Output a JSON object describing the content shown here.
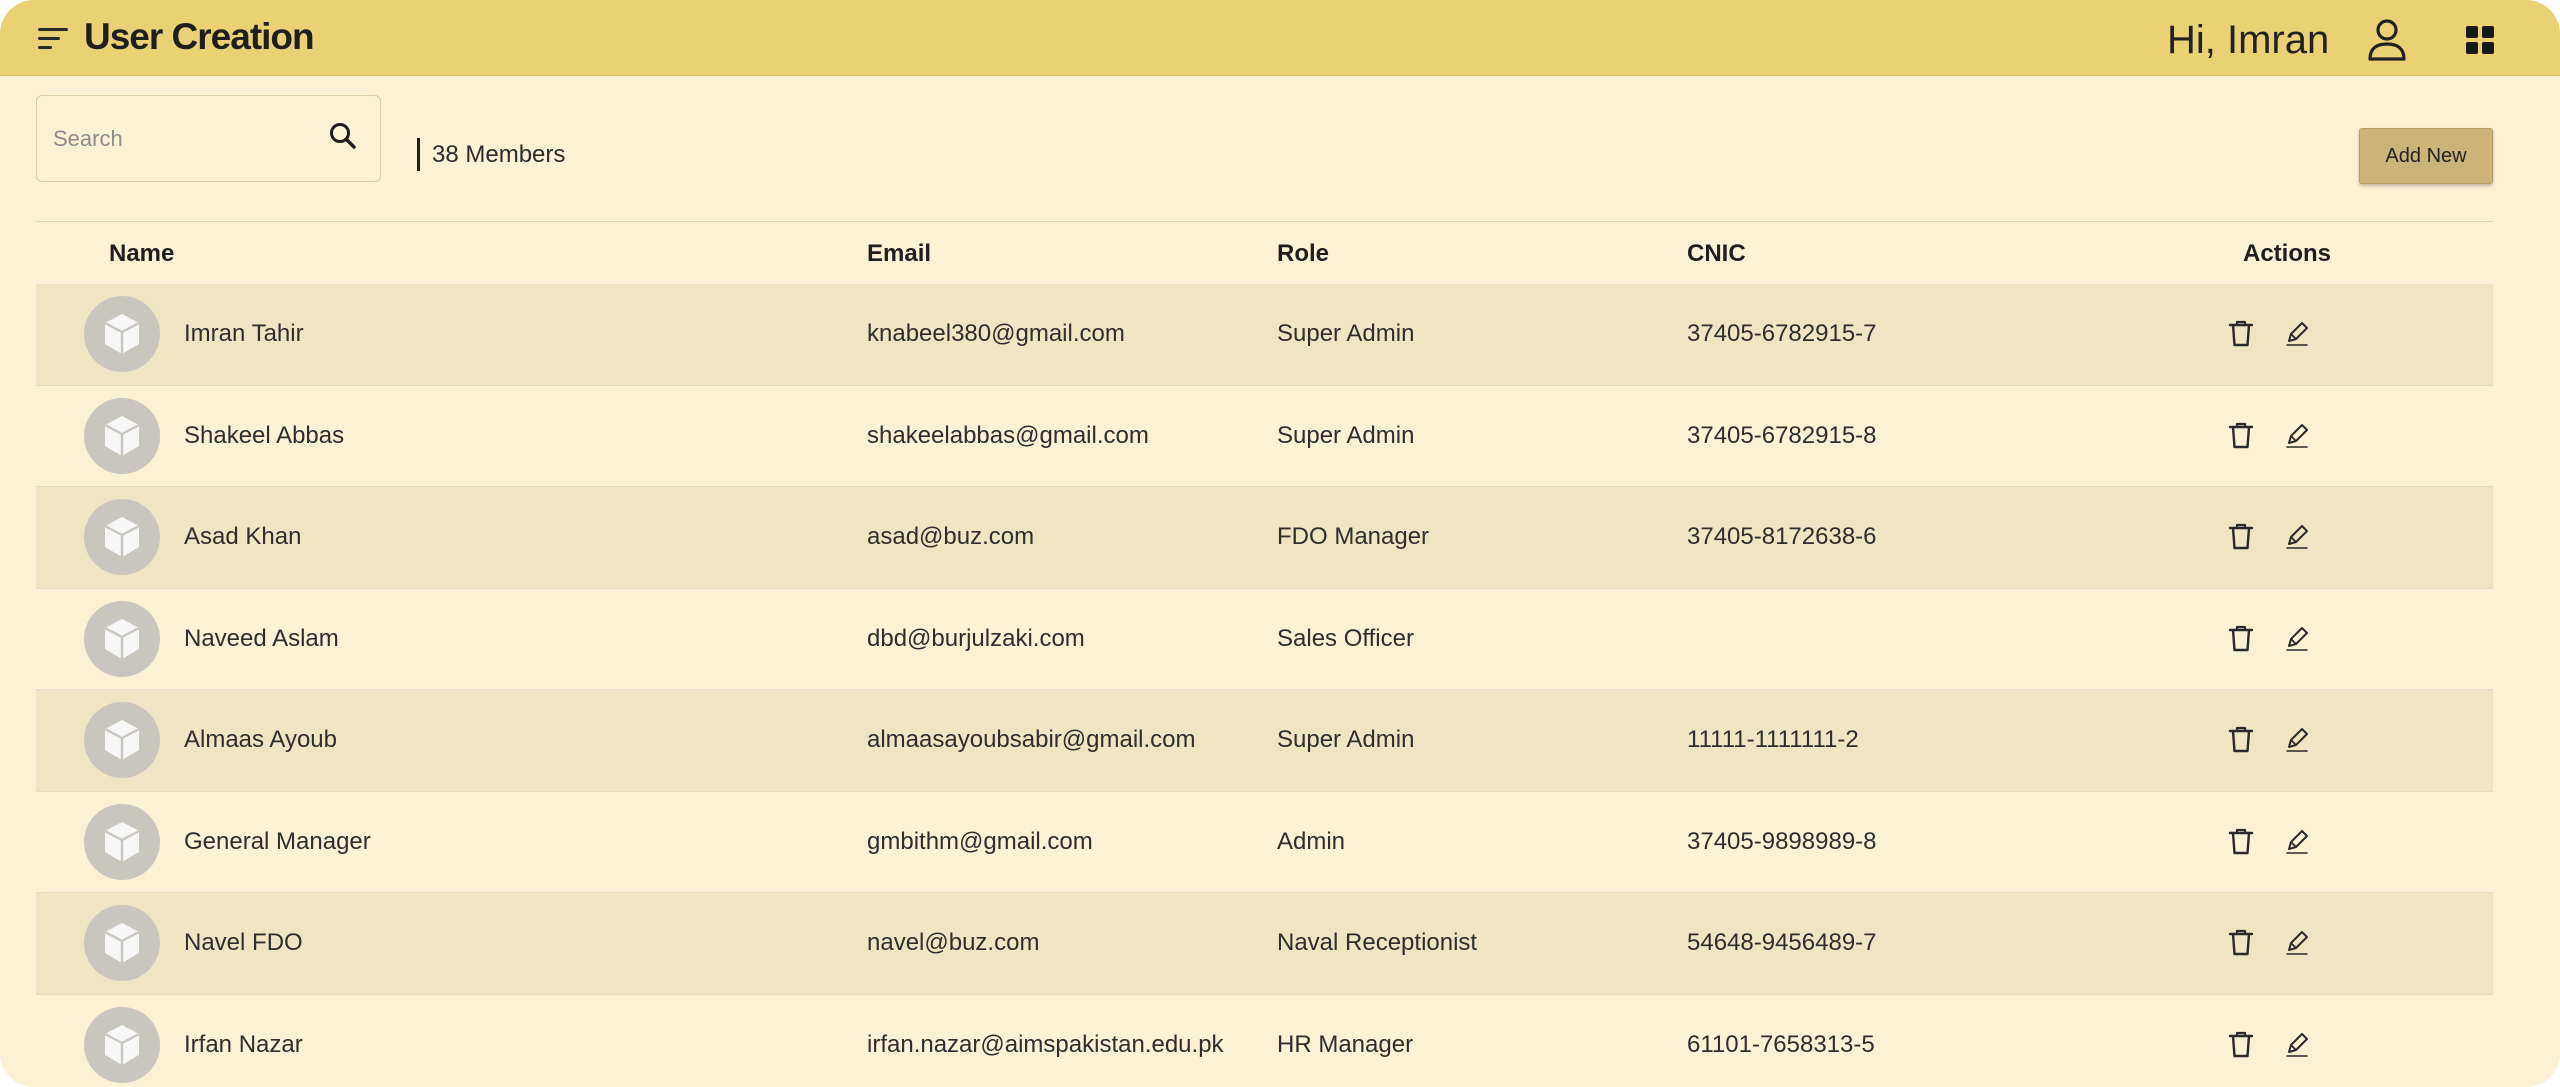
{
  "header": {
    "title": "User Creation",
    "greeting": "Hi, Imran",
    "menu_icon": "menu-sort-icon",
    "user_icon": "user-icon",
    "apps_icon": "grid-icon"
  },
  "toolbar": {
    "search_placeholder": "Search",
    "search_value": "",
    "members_count": "38 Members",
    "add_new_label": "Add New"
  },
  "table": {
    "columns": {
      "name": "Name",
      "email": "Email",
      "role": "Role",
      "cnic": "CNIC",
      "actions": "Actions"
    },
    "rows": [
      {
        "name": "Imran Tahir",
        "email": "knabeel380@gmail.com",
        "role": "Super Admin",
        "cnic": "37405-6782915-7"
      },
      {
        "name": "Shakeel Abbas",
        "email": "shakeelabbas@gmail.com",
        "role": "Super Admin",
        "cnic": "37405-6782915-8"
      },
      {
        "name": "Asad Khan",
        "email": "asad@buz.com",
        "role": "FDO Manager",
        "cnic": "37405-8172638-6"
      },
      {
        "name": "Naveed Aslam",
        "email": "dbd@burjulzaki.com",
        "role": "Sales Officer",
        "cnic": ""
      },
      {
        "name": "Almaas Ayoub",
        "email": "almaasayoubsabir@gmail.com",
        "role": "Super Admin",
        "cnic": "11111-1111111-2"
      },
      {
        "name": "General Manager",
        "email": "gmbithm@gmail.com",
        "role": "Admin",
        "cnic": "37405-9898989-8"
      },
      {
        "name": "Navel FDO",
        "email": "navel@buz.com",
        "role": "Naval Receptionist",
        "cnic": "54648-9456489-7"
      },
      {
        "name": "Irfan Nazar",
        "email": "irfan.nazar@aimspakistan.edu.pk",
        "role": "HR Manager",
        "cnic": "61101-7658313-5"
      }
    ]
  },
  "colors": {
    "header_bg": "#ead274",
    "page_bg": "#fbf1d5",
    "row_alt_bg": "#f0e5c3",
    "button_bg": "#cbb47a",
    "avatar_bg": "#c9c6c0"
  }
}
